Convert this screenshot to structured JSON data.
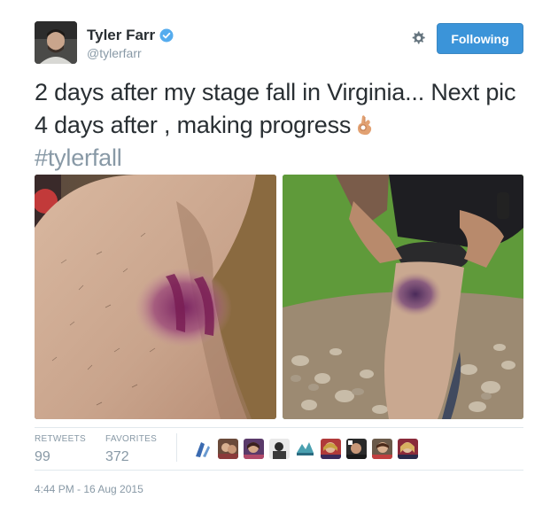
{
  "header": {
    "fullname": "Tyler Farr",
    "screenname": "@tylerfarr",
    "follow_label": "Following"
  },
  "tweet": {
    "text": "2 days after my stage fall in Virginia... Next pic 4 days after , making progress",
    "hashtag": "#tylerfall"
  },
  "stats": {
    "retweets_label": "RETWEETS",
    "retweets_count": "99",
    "favorites_label": "FAVORITES",
    "favorites_count": "372"
  },
  "timestamp": "4:44 PM - 16 Aug 2015",
  "icons": {
    "verified": "verified-badge-icon",
    "gear": "gear-icon",
    "emoji": "ok-hand-emoji"
  },
  "colors": {
    "accent": "#3b94d9",
    "muted": "#8899a6",
    "text": "#292f33"
  }
}
